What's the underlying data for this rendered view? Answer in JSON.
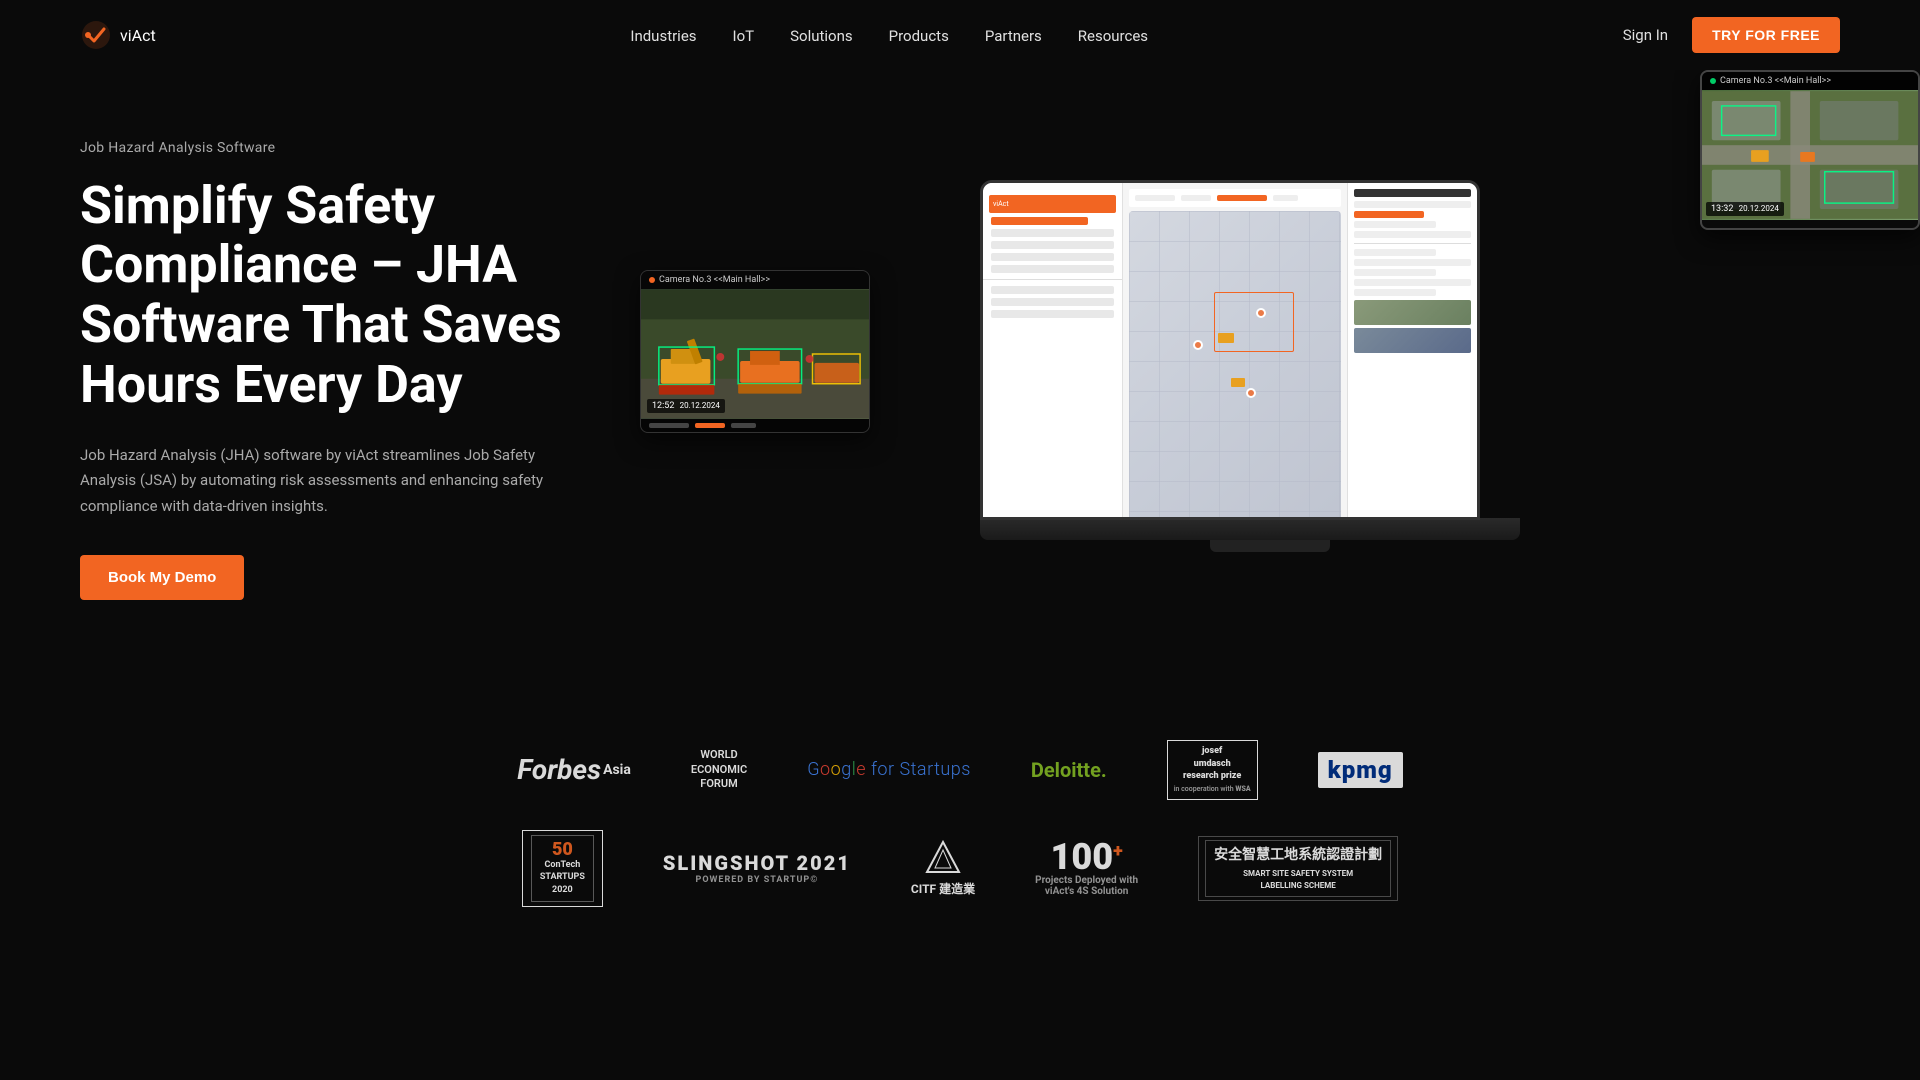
{
  "nav": {
    "logo_text": "viAct",
    "links": [
      {
        "label": "Industries",
        "id": "industries"
      },
      {
        "label": "IoT",
        "id": "iot"
      },
      {
        "label": "Solutions",
        "id": "solutions"
      },
      {
        "label": "Products",
        "id": "products"
      },
      {
        "label": "Partners",
        "id": "partners"
      },
      {
        "label": "Resources",
        "id": "resources"
      }
    ],
    "signin_label": "Sign In",
    "try_label": "TRY FOR FREE"
  },
  "hero": {
    "subtitle": "Job Hazard Analysis Software",
    "title": "Simplify Safety Compliance – JHA Software That Saves Hours Every Day",
    "description": "Job Hazard Analysis (JHA) software by viAct streamlines Job Safety Analysis (JSA) by automating risk assessments and enhancing safety compliance with data-driven insights.",
    "cta_label": "Book My Demo",
    "camera_label": "Camera No.3 <<Main Hall>>",
    "aerial_label": "Camera No.3 <<Main Hall>>",
    "aerial_time": "13:32",
    "camera_time": "12:52"
  },
  "brands": {
    "row1": [
      {
        "id": "forbes",
        "text": "Forbes Asia"
      },
      {
        "id": "wef",
        "text": "WORLD ECONOMIC FORUM"
      },
      {
        "id": "google",
        "text": "Google for Startups"
      },
      {
        "id": "deloitte",
        "text": "Deloitte."
      },
      {
        "id": "josef",
        "text": "josef umdasch research prize"
      },
      {
        "id": "kpmg",
        "text": "kpmg"
      }
    ],
    "row2": [
      {
        "id": "top50",
        "text": "TOP 50 ConTech Startups 2020"
      },
      {
        "id": "slingshot",
        "text": "SLINGSHOT 2021"
      },
      {
        "id": "citf",
        "text": "CITF"
      },
      {
        "id": "hundred",
        "text": "100+ Projects Deployed with viAct's 4S Solution"
      },
      {
        "id": "smart",
        "text": "安全智慧工地系統認證計劃 SMART SITE SAFETY SYSTEM LABELLING SCHEME"
      }
    ]
  }
}
